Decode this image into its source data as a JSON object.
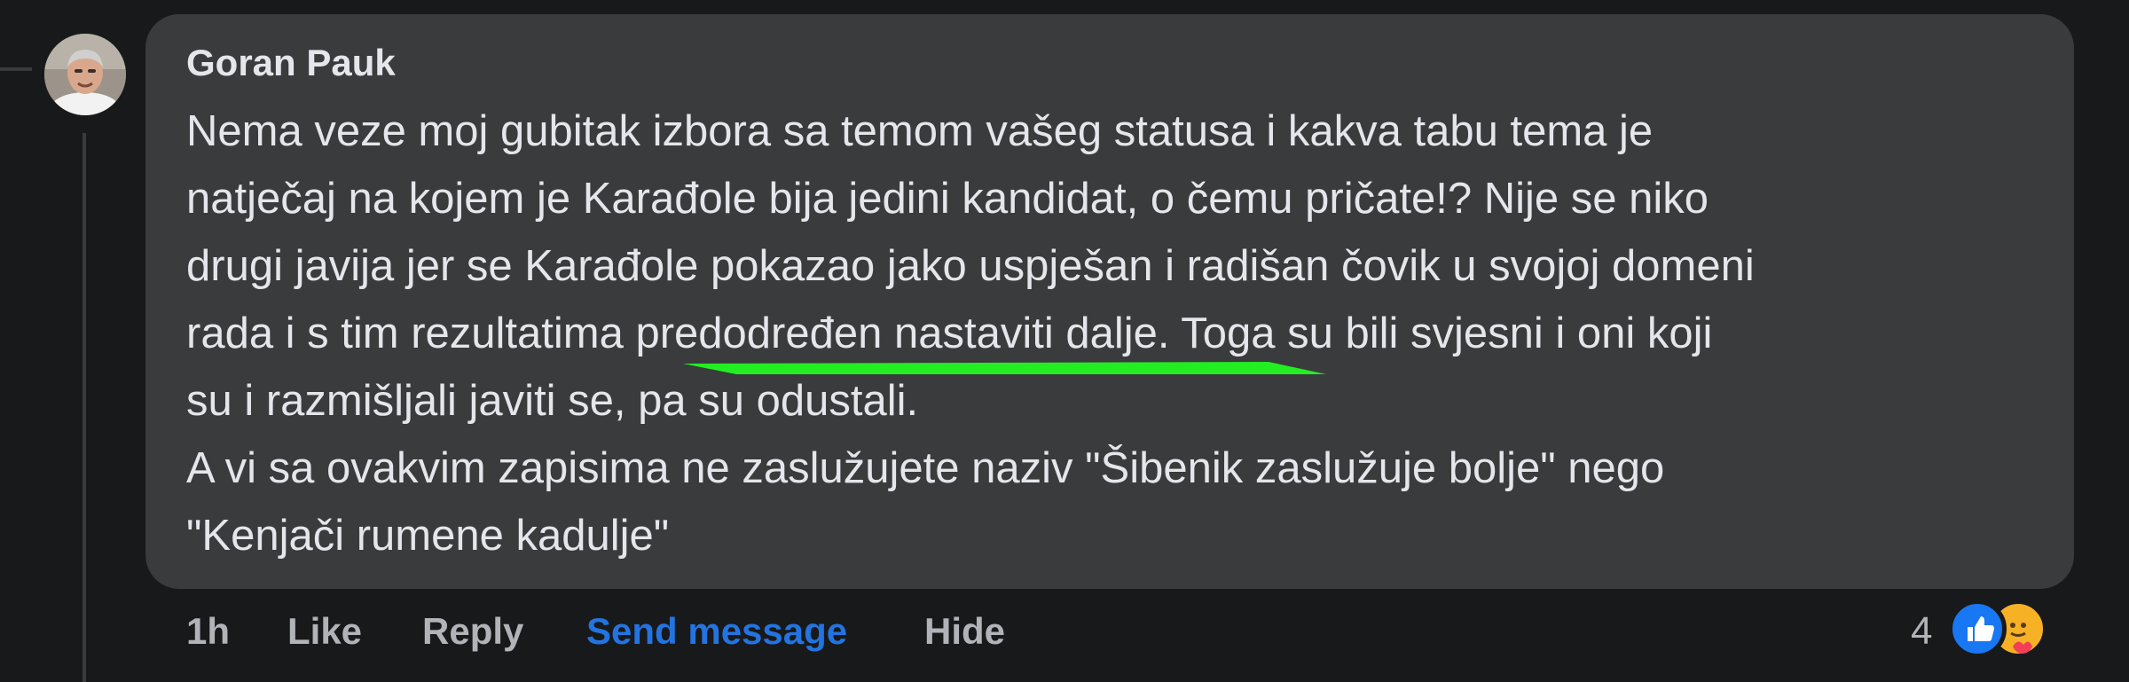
{
  "comment": {
    "author": "Goran Pauk",
    "lines": [
      "Nema veze moj gubitak izbora sa temom vašeg statusa i kakva tabu tema je",
      "natječaj na kojem je Karađole bija jedini kandidat, o čemu pričate!? Nije se niko",
      "drugi javija jer se Karađole pokazao jako uspješan i radišan čovik u svojoj domeni",
      "rada i s tim rezultatima predodređen nastaviti dalje. Toga su bili svjesni i oni koji",
      "su i razmišljali javiti se, pa su odustali.",
      "A vi sa ovakvim zapisima ne zaslužujete naziv \"Šibenik zaslužuje bolje\" nego",
      "\"Kenjači rumene kadulje\""
    ],
    "underline_color": "#22ee22"
  },
  "actions": {
    "time": "1h",
    "like": "Like",
    "reply": "Reply",
    "send_message": "Send message",
    "hide": "Hide"
  },
  "reactions": {
    "count": "4",
    "icons": [
      "like-reaction-icon",
      "care-reaction-icon"
    ],
    "like_color": "#1877f2",
    "care_color": "#f7b125"
  }
}
